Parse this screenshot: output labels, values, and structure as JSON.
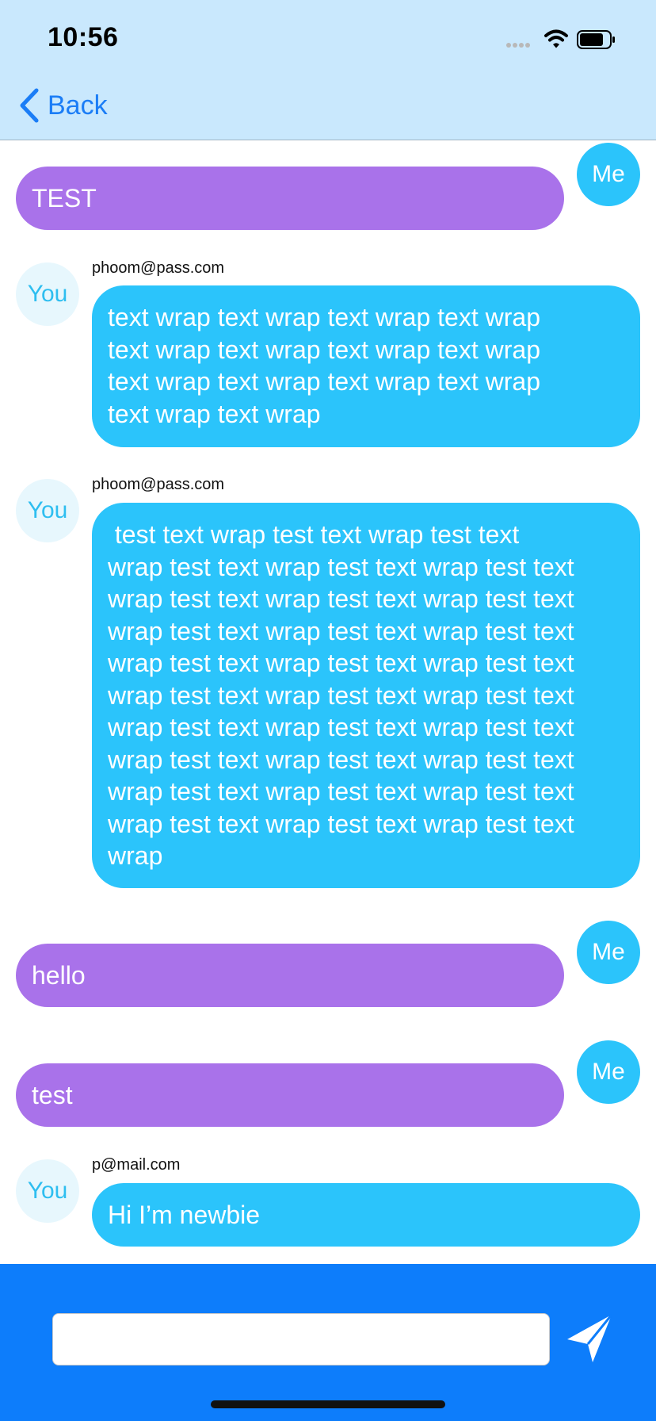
{
  "status_bar": {
    "time": "10:56"
  },
  "nav": {
    "back_label": "Back"
  },
  "messages": [
    {
      "side": "me",
      "avatar": "Me",
      "text": "TEST"
    },
    {
      "side": "you",
      "avatar": "You",
      "sender": "phoom@pass.com",
      "text": "text wrap text wrap text wrap text wrap\ntext wrap text wrap text wrap text wrap\ntext wrap text wrap text wrap text wrap\ntext wrap text wrap"
    },
    {
      "side": "you",
      "avatar": "You",
      "sender": "phoom@pass.com",
      "text": " test text wrap test text wrap test text\nwrap test text wrap test text wrap test text\nwrap test text wrap test text wrap test text\nwrap test text wrap test text wrap test text\nwrap test text wrap test text wrap test text\nwrap test text wrap test text wrap test text\nwrap test text wrap test text wrap test text\nwrap test text wrap test text wrap test text\nwrap test text wrap test text wrap test text\nwrap test text wrap test text wrap test text\nwrap"
    },
    {
      "side": "me",
      "avatar": "Me",
      "text": "hello"
    },
    {
      "side": "me",
      "avatar": "Me",
      "text": "test"
    },
    {
      "side": "you",
      "avatar": "You",
      "sender": "p@mail.com",
      "text": "Hi I’m newbie"
    }
  ],
  "composer": {
    "input_value": "",
    "send_icon": "paper-plane-icon"
  },
  "colors": {
    "header_bg": "#c9e8fd",
    "me_bubble": "#a972ea",
    "you_bubble": "#2bc4fb",
    "composer_bg": "#0d7dfb",
    "link_blue": "#1b7df6"
  }
}
